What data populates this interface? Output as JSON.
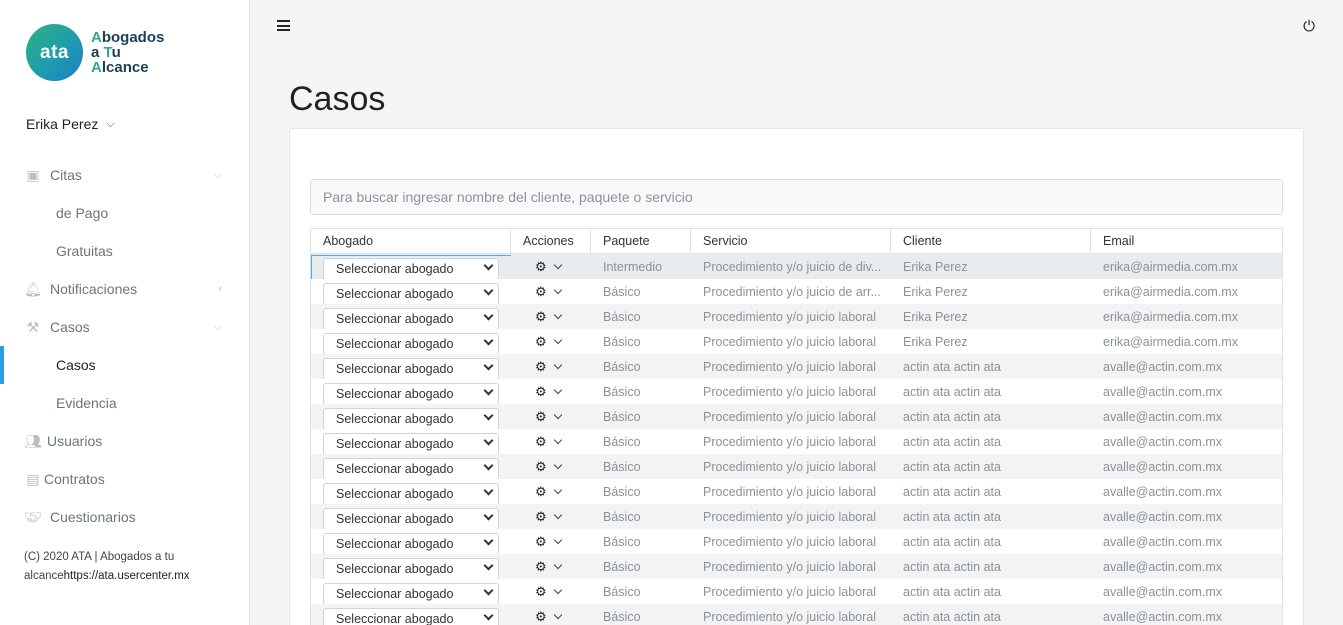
{
  "brand": {
    "logo_mark": "ata",
    "name_line1": "Abogados",
    "name_line2": "a Tu",
    "name_line3": "Alcance"
  },
  "user": {
    "name": "Erika Perez"
  },
  "sidebar": {
    "items": [
      {
        "label": "Citas",
        "icon": "calendar-icon"
      },
      {
        "label": "de Pago"
      },
      {
        "label": "Gratuitas"
      },
      {
        "label": "Notificaciones",
        "icon": "bell-icon"
      },
      {
        "label": "Casos",
        "icon": "gavel-icon"
      },
      {
        "label": "Casos",
        "active": true
      },
      {
        "label": "Evidencia"
      },
      {
        "label": "Usuarios",
        "icon": "users-icon"
      },
      {
        "label": "Contratos",
        "icon": "file-icon"
      },
      {
        "label": "Cuestionarios",
        "icon": "handshake-icon"
      }
    ],
    "footer_line1": "(C) 2020 ATA | Abogados a tu",
    "footer_line2_a": "alcance",
    "footer_line2_b": "https://ata.usercenter.mx"
  },
  "page": {
    "title": "Casos"
  },
  "search": {
    "placeholder": "Para buscar ingresar nombre del cliente, paquete o servicio"
  },
  "table": {
    "headers": [
      "Abogado",
      "Acciones",
      "Paquete",
      "Servicio",
      "Cliente",
      "Email"
    ],
    "select_label": "Seleccionar abogado",
    "rows": [
      {
        "paquete": "Intermedio",
        "servicio": "Procedimiento y/o juicio de div...",
        "cliente": "Erika Perez",
        "email": "erika@airmedia.com.mx"
      },
      {
        "paquete": "Básico",
        "servicio": "Procedimiento y/o juicio de arr...",
        "cliente": "Erika Perez",
        "email": "erika@airmedia.com.mx"
      },
      {
        "paquete": "Básico",
        "servicio": "Procedimiento y/o juicio laboral",
        "cliente": "Erika Perez",
        "email": "erika@airmedia.com.mx"
      },
      {
        "paquete": "Básico",
        "servicio": "Procedimiento y/o juicio laboral",
        "cliente": "Erika Perez",
        "email": "erika@airmedia.com.mx"
      },
      {
        "paquete": "Básico",
        "servicio": "Procedimiento y/o juicio laboral",
        "cliente": "actin ata actin ata",
        "email": "avalle@actin.com.mx"
      },
      {
        "paquete": "Básico",
        "servicio": "Procedimiento y/o juicio laboral",
        "cliente": "actin ata actin ata",
        "email": "avalle@actin.com.mx"
      },
      {
        "paquete": "Básico",
        "servicio": "Procedimiento y/o juicio laboral",
        "cliente": "actin ata actin ata",
        "email": "avalle@actin.com.mx"
      },
      {
        "paquete": "Básico",
        "servicio": "Procedimiento y/o juicio laboral",
        "cliente": "actin ata actin ata",
        "email": "avalle@actin.com.mx"
      },
      {
        "paquete": "Básico",
        "servicio": "Procedimiento y/o juicio laboral",
        "cliente": "actin ata actin ata",
        "email": "avalle@actin.com.mx"
      },
      {
        "paquete": "Básico",
        "servicio": "Procedimiento y/o juicio laboral",
        "cliente": "actin ata actin ata",
        "email": "avalle@actin.com.mx"
      },
      {
        "paquete": "Básico",
        "servicio": "Procedimiento y/o juicio laboral",
        "cliente": "actin ata actin ata",
        "email": "avalle@actin.com.mx"
      },
      {
        "paquete": "Básico",
        "servicio": "Procedimiento y/o juicio laboral",
        "cliente": "actin ata actin ata",
        "email": "avalle@actin.com.mx"
      },
      {
        "paquete": "Básico",
        "servicio": "Procedimiento y/o juicio laboral",
        "cliente": "actin ata actin ata",
        "email": "avalle@actin.com.mx"
      },
      {
        "paquete": "Básico",
        "servicio": "Procedimiento y/o juicio laboral",
        "cliente": "actin ata actin ata",
        "email": "avalle@actin.com.mx"
      },
      {
        "paquete": "Básico",
        "servicio": "Procedimiento y/o juicio laboral",
        "cliente": "actin ata actin ata",
        "email": "avalle@actin.com.mx"
      }
    ]
  },
  "colors": {
    "accent": "#2b9be6",
    "brand_green": "#2fa88b",
    "brand_dark": "#1c3e57"
  }
}
